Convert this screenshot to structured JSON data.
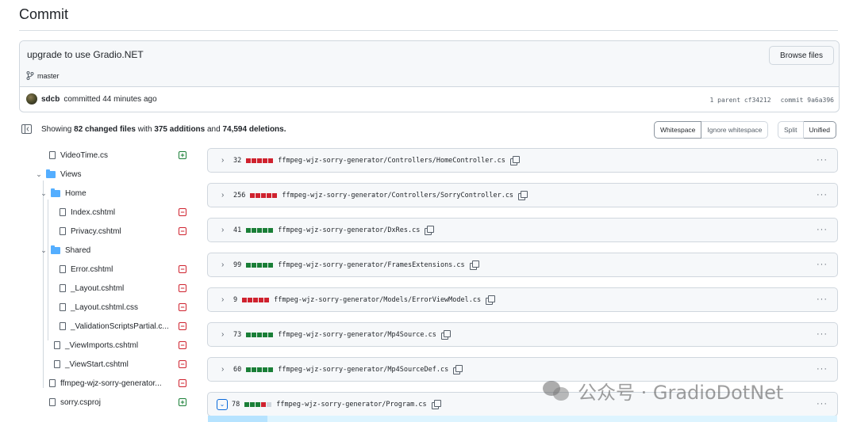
{
  "page_title": "Commit",
  "commit": {
    "message": "upgrade to use Gradio.NET",
    "browse_label": "Browse files",
    "branch": "master",
    "author": "sdcb",
    "time_text": "committed 44 minutes ago",
    "parent_text": "1 parent cf34212",
    "commit_text": "commit 9a6a396"
  },
  "summary": {
    "prefix": "Showing",
    "changed": "82 changed files",
    "with": "with",
    "additions": "375 additions",
    "and": "and",
    "deletions": "74,594 deletions."
  },
  "view_options": {
    "whitespace": "Whitespace",
    "ignore_whitespace": "Ignore whitespace",
    "split": "Split",
    "unified": "Unified"
  },
  "file_tree": [
    {
      "label": "VideoTime.cs",
      "type": "file",
      "status": "added"
    },
    {
      "label": "Views",
      "type": "folder"
    },
    {
      "label": "Home",
      "type": "folder"
    },
    {
      "label": "Index.cshtml",
      "type": "file",
      "status": "deleted"
    },
    {
      "label": "Privacy.cshtml",
      "type": "file",
      "status": "deleted"
    },
    {
      "label": "Shared",
      "type": "folder"
    },
    {
      "label": "Error.cshtml",
      "type": "file",
      "status": "deleted"
    },
    {
      "label": "_Layout.cshtml",
      "type": "file",
      "status": "deleted"
    },
    {
      "label": "_Layout.cshtml.css",
      "type": "file",
      "status": "deleted"
    },
    {
      "label": "_ValidationScriptsPartial.c...",
      "type": "file",
      "status": "deleted"
    },
    {
      "label": "_ViewImports.cshtml",
      "type": "file",
      "status": "deleted"
    },
    {
      "label": "_ViewStart.cshtml",
      "type": "file",
      "status": "deleted"
    },
    {
      "label": "ffmpeg-wjz-sorry-generator...",
      "type": "file",
      "status": "deleted"
    },
    {
      "label": "sorry.csproj",
      "type": "file",
      "status": "added"
    }
  ],
  "diffs": [
    {
      "count": "32",
      "blocks": "rrrrr",
      "path": "ffmpeg-wjz-sorry-generator/Controllers/HomeController.cs"
    },
    {
      "count": "256",
      "blocks": "rrrrr",
      "path": "ffmpeg-wjz-sorry-generator/Controllers/SorryController.cs"
    },
    {
      "count": "41",
      "blocks": "ggggg",
      "path": "ffmpeg-wjz-sorry-generator/DxRes.cs"
    },
    {
      "count": "99",
      "blocks": "ggggg",
      "path": "ffmpeg-wjz-sorry-generator/FramesExtensions.cs"
    },
    {
      "count": "9",
      "blocks": "rrrrr",
      "path": "ffmpeg-wjz-sorry-generator/Models/ErrorViewModel.cs"
    },
    {
      "count": "73",
      "blocks": "ggggg",
      "path": "ffmpeg-wjz-sorry-generator/Mp4Source.cs"
    },
    {
      "count": "60",
      "blocks": "ggggg",
      "path": "ffmpeg-wjz-sorry-generator/Mp4SourceDef.cs"
    },
    {
      "count": "78",
      "blocks": "gggrn",
      "path": "ffmpeg-wjz-sorry-generator/Program.cs"
    }
  ],
  "watermark": "公众号 · GradioDotNet",
  "colors": {
    "added": "#1a7f37",
    "deleted": "#cf222e",
    "folder": "#54aeff",
    "accent": "#0969da"
  }
}
